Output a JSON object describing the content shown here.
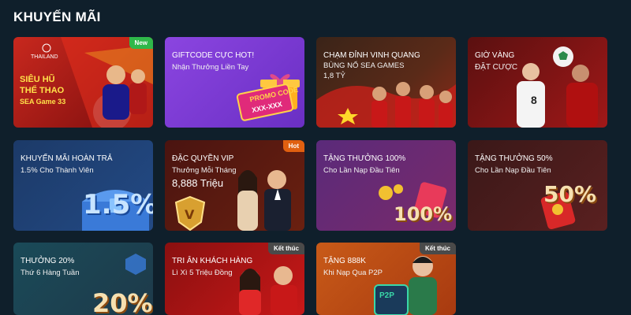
{
  "page": {
    "title": "KHUYẾN MÃI"
  },
  "cards": [
    {
      "brand": "THAILAND",
      "lines": [
        "SIÊU HŨ",
        "THỂ THAO",
        "SEA Game 33"
      ],
      "badge": "New"
    },
    {
      "title": "GIFTCODE CỰC HOT!",
      "subtitle": "Nhận Thưởng Liền Tay",
      "promo_text": "PROMO CODE",
      "promo_mask": "XXX-XXX"
    },
    {
      "title": "CHẠM ĐỈNH VINH QUANG",
      "subtitle": "BÙNG NỔ SEA GAMES",
      "amount": "1,8 TỶ"
    },
    {
      "title": "GIỜ VÀNG",
      "subtitle": "ĐẶT CƯỢC",
      "jersey_number": "8"
    },
    {
      "title": "KHUYẾN MÃI HOÀN TRẢ",
      "subtitle": "1.5% Cho Thành Viên",
      "big_text": "1.5%"
    },
    {
      "title": "ĐẶC QUYỀN VIP",
      "subtitle": "Thưởng Mỗi Tháng",
      "amount": "8,888 Triệu",
      "badge": "Hot"
    },
    {
      "title": "TẶNG THƯỞNG 100%",
      "subtitle": "Cho Lần Nạp Đầu Tiên",
      "big_text": "100%"
    },
    {
      "title": "TẶNG THƯỞNG 50%",
      "subtitle": "Cho Lần Nạp Đầu Tiên",
      "big_text": "50%"
    },
    {
      "title": "THƯỞNG 20%",
      "subtitle": "Thứ 6 Hàng Tuần",
      "big_text": "20%"
    },
    {
      "title": "TRI ÂN KHÁCH HÀNG",
      "subtitle": "Lì Xì 5 Triệu Đồng",
      "badge": "Kết thúc"
    },
    {
      "title": "TẶNG 888K",
      "subtitle": "Khi Nạp Qua P2P",
      "badge": "Kết thúc",
      "p2p_label": "P2P"
    }
  ],
  "colors": {
    "background": "#0f1f2b",
    "badge_new": "#2fb84a",
    "badge_hot": "#e06010",
    "badge_end": "#4a4a4a"
  }
}
